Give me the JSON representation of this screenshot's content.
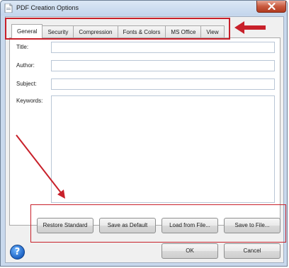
{
  "window": {
    "title": "PDF Creation Options"
  },
  "tabs": [
    {
      "label": "General",
      "active": true
    },
    {
      "label": "Security",
      "active": false
    },
    {
      "label": "Compression",
      "active": false
    },
    {
      "label": "Fonts & Colors",
      "active": false
    },
    {
      "label": "MS Office",
      "active": false
    },
    {
      "label": "View",
      "active": false
    }
  ],
  "fields": {
    "title_label": "Title:",
    "title_value": "",
    "author_label": "Author:",
    "author_value": "",
    "subject_label": "Subject:",
    "subject_value": "",
    "keywords_label": "Keywords:",
    "keywords_value": ""
  },
  "buttons": {
    "restore_standard": "Restore Standard",
    "save_as_default": "Save as Default",
    "load_from_file": "Load from File...",
    "save_to_file": "Save to File...",
    "ok": "OK",
    "cancel": "Cancel",
    "help": "?"
  },
  "annotation_color": "#c8202a",
  "icons": {
    "app": "pdf-printer-icon",
    "close": "close-icon",
    "help": "help-icon"
  }
}
